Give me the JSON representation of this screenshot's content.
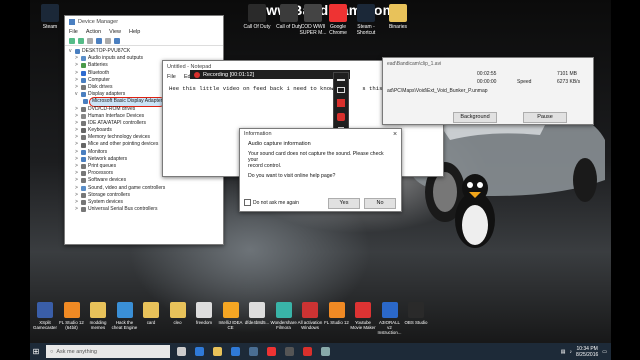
{
  "watermark": "www.Bandicam.com",
  "desktop_icons_top": [
    {
      "label": "Steam",
      "name": "steam-icon",
      "color": "#1b2838"
    },
    {
      "label": "Call of Duty",
      "name": "cod-icon",
      "color": "#3b3b3b"
    },
    {
      "label": "COD WWII SUPER M...",
      "name": "cod-wwii-icon",
      "color": "#444"
    },
    {
      "label": "Google Chrome",
      "name": "chrome-icon",
      "color": "#e33"
    },
    {
      "label": "Steam - Shortcut",
      "name": "steam-shortcut-icon",
      "color": "#1b2838"
    },
    {
      "label": "Binaries",
      "name": "folder-icon",
      "color": "#e8c25a"
    }
  ],
  "top_icon_partial": "Call Of Duty",
  "device_manager": {
    "title": "Device Manager",
    "menu": [
      "File",
      "Action",
      "View",
      "Help"
    ],
    "root": "DESKTOP-PVU87CK",
    "nodes": [
      {
        "label": "Audio inputs and outputs",
        "arrow": ">",
        "color": "#5a8ec8"
      },
      {
        "label": "Batteries",
        "arrow": ">",
        "color": "#4a9a4a"
      },
      {
        "label": "Bluetooth",
        "arrow": ">",
        "color": "#2d6bd1"
      },
      {
        "label": "Computer",
        "arrow": ">",
        "color": "#4a7fc0"
      },
      {
        "label": "Disk drives",
        "arrow": ">",
        "color": "#777"
      },
      {
        "label": "Display adapters",
        "arrow": "v",
        "color": "#4a7fc0"
      },
      {
        "label": "Microsoft Basic Display Adapter",
        "arrow": "",
        "color": "#4a7fc0",
        "highlight": true
      },
      {
        "label": "DVD/CD-ROM drives",
        "arrow": ">",
        "color": "#777"
      },
      {
        "label": "Human Interface Devices",
        "arrow": ">",
        "color": "#888"
      },
      {
        "label": "IDE ATA/ATAPI controllers",
        "arrow": ">",
        "color": "#777"
      },
      {
        "label": "Keyboards",
        "arrow": ">",
        "color": "#666"
      },
      {
        "label": "Memory technology devices",
        "arrow": ">",
        "color": "#777"
      },
      {
        "label": "Mice and other pointing devices",
        "arrow": ">",
        "color": "#666"
      },
      {
        "label": "Monitors",
        "arrow": ">",
        "color": "#4a7fc0"
      },
      {
        "label": "Network adapters",
        "arrow": ">",
        "color": "#4a7fc0"
      },
      {
        "label": "Print queues",
        "arrow": ">",
        "color": "#777"
      },
      {
        "label": "Processors",
        "arrow": ">",
        "color": "#777"
      },
      {
        "label": "Software devices",
        "arrow": ">",
        "color": "#777"
      },
      {
        "label": "Sound, video and game controllers",
        "arrow": ">",
        "color": "#5a8ec8"
      },
      {
        "label": "Storage controllers",
        "arrow": ">",
        "color": "#777"
      },
      {
        "label": "System devices",
        "arrow": ">",
        "color": "#777"
      },
      {
        "label": "Universal Serial Bus controllers",
        "arrow": ">",
        "color": "#777"
      }
    ]
  },
  "notepad": {
    "title": "Untitled - Notepad",
    "menu": [
      "File",
      "Edit"
    ],
    "text": "Hee this little video on feed back i need to know ji",
    "text_tail": "s this as my graphis card"
  },
  "recording": {
    "label": "Recording [00:01:12]",
    "accent": "#d9302c"
  },
  "bandicam_panel": {
    "path_partial": "ead\\Bandicam\\clip_1.avi",
    "rows": [
      {
        "time": "00:02:55",
        "value": "7101 MB"
      },
      {
        "time": "00:00:00",
        "label": "Speed",
        "value": "6273 KB/s"
      }
    ],
    "file_path": "ad\\PC\\Maps\\Void\\Ext_Void_Bunker_P.unmap",
    "background_btn": "Background",
    "pause_btn": "Pause"
  },
  "dialog": {
    "title": "Information",
    "heading": "Audio capture information",
    "line1": "Your sound card does not capture the sound. Please check your",
    "line2": "record control.",
    "line3": "Do you want to visit online help page?",
    "checkbox": "Do not ask me again",
    "yes": "Yes",
    "no": "No"
  },
  "desktop_icons_bottom": [
    {
      "label": "XSplit Gamecaster",
      "name": "xsplit-icon",
      "color": "#3a5ea8"
    },
    {
      "label": "FL Studio 12 (64bit)",
      "name": "fl-studio-icon",
      "color": "#f08a24"
    },
    {
      "label": "modding memes",
      "name": "folder-icon",
      "color": "#e8c25a"
    },
    {
      "label": "Hack the cheat Engine",
      "name": "cheat-engine-icon",
      "color": "#3a8fd6"
    },
    {
      "label": "card",
      "name": "folder-icon",
      "color": "#e8c25a"
    },
    {
      "label": "cleo",
      "name": "folder-icon",
      "color": "#e8c25a"
    },
    {
      "label": "freedom",
      "name": "file-icon",
      "color": "#ddd"
    },
    {
      "label": "IntelliJ IDEA CE",
      "name": "intellij-icon",
      "color": "#f5a623"
    },
    {
      "label": "dfde4b8d5...",
      "name": "file-icon",
      "color": "#ddd"
    },
    {
      "label": "Wondershare Filmora",
      "name": "filmora-icon",
      "color": "#39b4a8"
    },
    {
      "label": "All activation Windows",
      "name": "activation-icon",
      "color": "#c33"
    },
    {
      "label": "FL Studio 12",
      "name": "fl-studio-icon",
      "color": "#f08a24"
    },
    {
      "label": "Youtube Movie Maker",
      "name": "youtube-maker-icon",
      "color": "#d33"
    },
    {
      "label": "A3IORALL v2 Instruction...",
      "name": "doc-icon",
      "color": "#2b68c9"
    },
    {
      "label": "OBS Studio",
      "name": "obs-icon",
      "color": "#2a2a2a"
    }
  ],
  "taskbar": {
    "search_placeholder": "Ask me anything",
    "apps": [
      {
        "name": "task-view-icon",
        "color": "#ccc"
      },
      {
        "name": "edge-icon",
        "color": "#2f7ad8"
      },
      {
        "name": "file-explorer-icon",
        "color": "#e8c25a"
      },
      {
        "name": "store-icon",
        "color": "#2f7ad8"
      },
      {
        "name": "steam-taskbar-icon",
        "color": "#4a6e93"
      },
      {
        "name": "chrome-taskbar-icon",
        "color": "#e33"
      },
      {
        "name": "obs-taskbar-icon",
        "color": "#555"
      },
      {
        "name": "bandicam-taskbar-icon",
        "color": "#d9302c"
      },
      {
        "name": "device-manager-taskbar-icon",
        "color": "#8aa"
      }
    ],
    "time": "10:34 PM",
    "date": "8/25/2016"
  }
}
